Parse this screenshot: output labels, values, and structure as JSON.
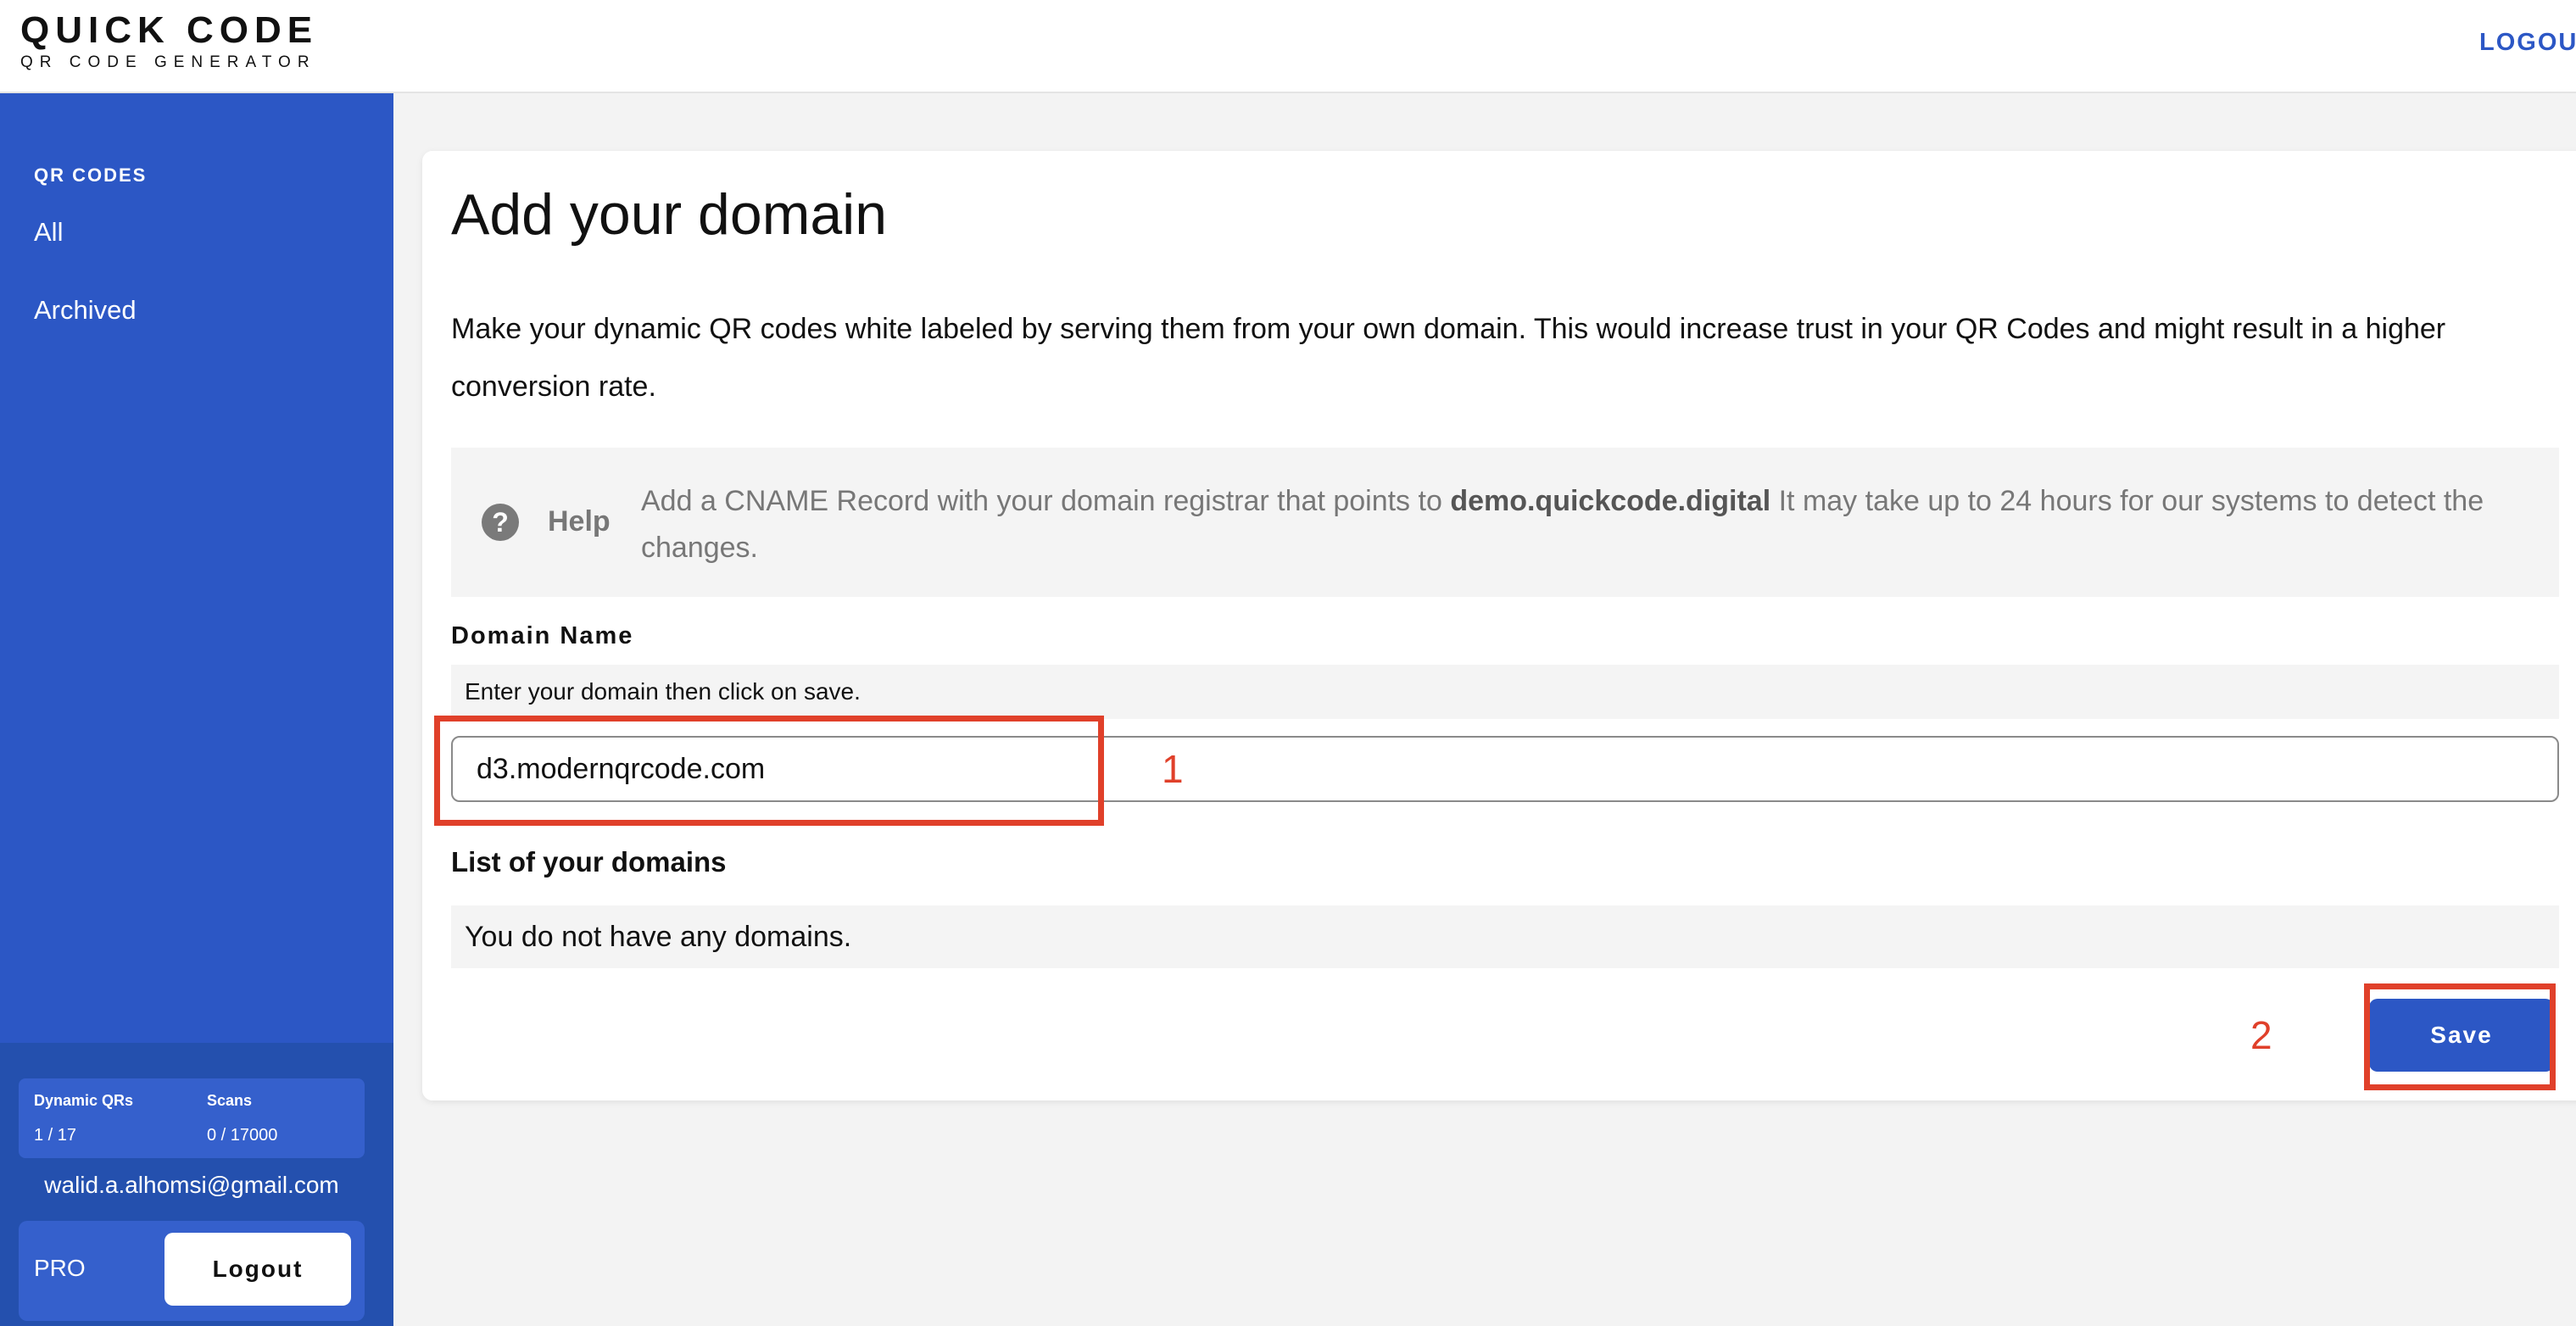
{
  "header": {
    "brand_title": "QUICK CODE",
    "brand_subtitle": "QR CODE GENERATOR",
    "logout_label": "LOGOUT"
  },
  "sidebar": {
    "section_title": "QR CODES",
    "items": [
      {
        "label": "All"
      },
      {
        "label": "Archived"
      }
    ],
    "stats": {
      "dynamic_label": "Dynamic QRs",
      "dynamic_value": "1 / 17",
      "scans_label": "Scans",
      "scans_value": "0 / 17000"
    },
    "user_email": "walid.a.alhomsi@gmail.com",
    "plan_label": "PRO",
    "logout_label": "Logout"
  },
  "main": {
    "title": "Add your domain",
    "intro": "Make your dynamic QR codes white labeled by serving them from your own domain. This would increase trust in your QR Codes and might result in a higher conversion rate.",
    "help": {
      "icon": "question-circle-icon",
      "label": "Help",
      "text_before": "Add a CNAME Record with your domain registrar that points to ",
      "domain": "demo.quickcode.digital",
      "text_after": " It may take up to 24 hours for our systems to detect the changes."
    },
    "domain_field": {
      "label": "Domain Name",
      "hint": "Enter your domain then click on save.",
      "value": "d3.modernqrcode.com"
    },
    "domains_list": {
      "title": "List of your domains",
      "empty_text": "You do not have any domains."
    },
    "save_label": "Save"
  },
  "annotations": {
    "step1": "1",
    "step2": "2",
    "color": "#e0402a"
  },
  "colors": {
    "brand_blue": "#2c57c5",
    "sidebar_footer": "#2450ae",
    "panel_gray": "#f4f4f4",
    "help_text_gray": "#777777"
  }
}
